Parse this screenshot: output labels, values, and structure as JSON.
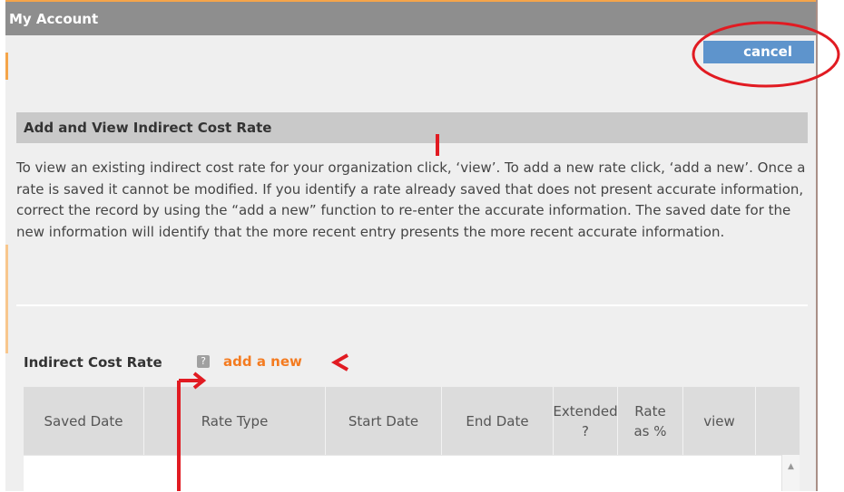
{
  "window": {
    "title": "My Account"
  },
  "toolbar": {
    "cancel_label": "cancel"
  },
  "section": {
    "heading": "Add and View Indirect Cost Rate",
    "description": "To view an existing indirect cost rate for your organization click, ‘view’. To add a new rate click, ‘add a new’. Once a rate is saved it cannot be modified. If you identify a rate already saved that does not present accurate information, correct the record by using the “add a new” function to re-enter the accurate information. The saved date for the new information will identify that the more recent entry presents the more recent accurate information."
  },
  "rates": {
    "label": "Indirect Cost Rate",
    "help_icon": "?",
    "add_link": "add a new",
    "columns": [
      "Saved Date",
      "Rate Type",
      "Start Date",
      "End Date",
      "Extended ?",
      "Rate as %",
      "view"
    ]
  },
  "annotations": {
    "color": "#e11b22"
  }
}
